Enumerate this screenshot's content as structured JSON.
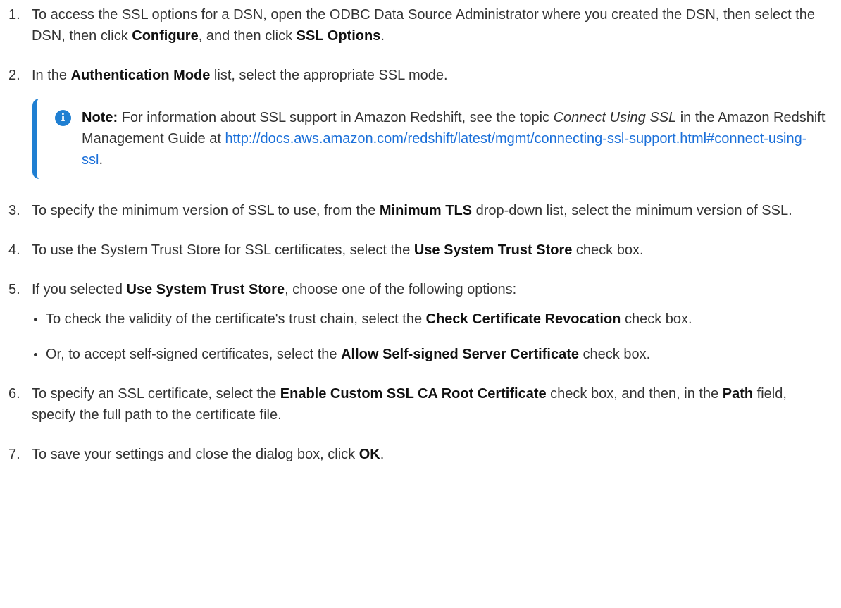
{
  "steps": [
    {
      "num": "1.",
      "t0": "To access the SSL options for a DSN, open the ODBC Data Source Administrator where you created the DSN, then select the DSN, then click ",
      "b0": "Configure",
      "t1": ", and then click ",
      "b1": "SSL Options",
      "t2": "."
    },
    {
      "num": "2.",
      "t0": "In the ",
      "b0": "Authentication Mode",
      "t1": " list, select the appropriate SSL mode."
    },
    {
      "num": "3.",
      "t0": "To specify the minimum version of SSL to use, from the ",
      "b0": "Minimum TLS",
      "t1": " drop-down list, select the minimum version of SSL."
    },
    {
      "num": "4.",
      "t0": "To use the System Trust Store for SSL certificates, select the ",
      "b0": "Use System Trust Store",
      "t1": " check box."
    },
    {
      "num": "5.",
      "t0": "If you selected ",
      "b0": "Use System Trust Store",
      "t1": ", choose one of the following options:",
      "bullets": [
        {
          "t0": "To check the validity of the certificate's trust chain, select the ",
          "b0": "Check Certificate Revocation",
          "t1": " check box."
        },
        {
          "t0": "Or, to accept self-signed certificates, select the ",
          "b0": "Allow Self-signed Server Certificate",
          "t1": " check box."
        }
      ]
    },
    {
      "num": "6.",
      "t0": "To specify an SSL certificate, select the ",
      "b0": "Enable Custom SSL CA Root Certificate",
      "t1": " check box, and then, in the ",
      "b1": "Path",
      "t2": " field, specify the full path to the certificate file."
    },
    {
      "num": "7.",
      "t0": "To save your settings and close the dialog box, click ",
      "b0": "OK",
      "t1": "."
    }
  ],
  "note": {
    "icon": "info-icon",
    "icon_glyph": "i",
    "label": "Note:",
    "t0": " For information about SSL support in Amazon Redshift, see the topic ",
    "topic": "Connect Using SSL",
    "t1": " in the Amazon Redshift Management Guide at ",
    "link": "http://docs.aws.amazon.com/redshift/latest/mgmt/connecting-ssl-support.html#connect-using-ssl",
    "t2": "."
  },
  "colors": {
    "accent": "#1f7fd2",
    "link": "#1a6fd9",
    "text": "#333333"
  }
}
